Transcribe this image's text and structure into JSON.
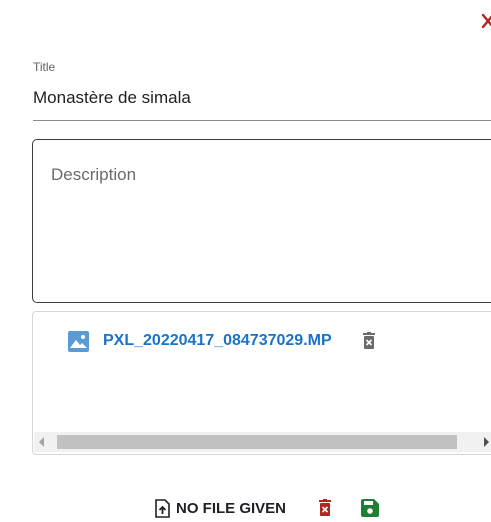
{
  "close_label": "Close",
  "form": {
    "title_label": "Title",
    "title_value": "Monastère de simala",
    "description_placeholder": "Description"
  },
  "files": [
    {
      "name": "PXL_20220417_084737029.MP",
      "icon": "image-icon",
      "delete_icon": "delete-forever-icon"
    }
  ],
  "actions": {
    "upload_label": "NO FILE GIVEN",
    "upload_icon": "file-upload-icon",
    "delete_icon": "delete-forever-icon",
    "save_icon": "save-icon"
  },
  "colors": {
    "close": "#b3261e",
    "file_link": "#1a73c8",
    "image_icon": "#4a90d9",
    "delete": "#b3261e",
    "save": "#1e7e34",
    "file_delete": "#6b6b6b"
  }
}
